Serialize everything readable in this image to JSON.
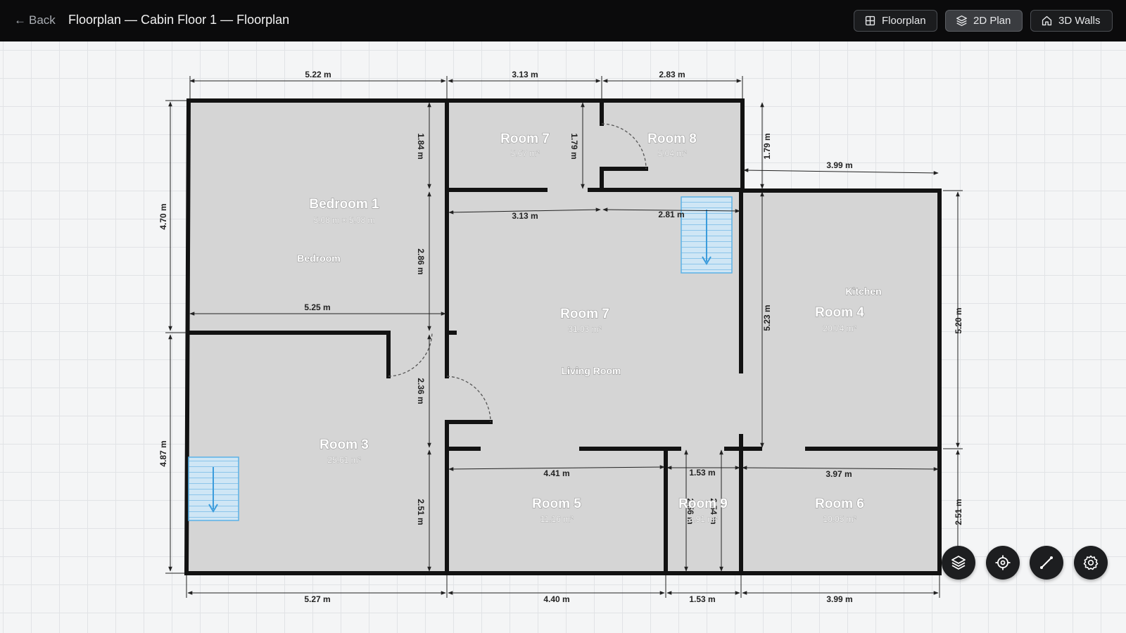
{
  "topbar": {
    "back_label": "Back",
    "title": "Floorplan — Cabin Floor 1 — Floorplan",
    "buttons": [
      {
        "label": "Floorplan",
        "icon": "grid-icon",
        "active": false
      },
      {
        "label": "2D Plan",
        "icon": "layers-icon",
        "active": true
      },
      {
        "label": "3D Walls",
        "icon": "home-icon",
        "active": false
      }
    ]
  },
  "rooms": {
    "bedroom1": {
      "name": "Bedroom 1",
      "area": "5.08 m × 5.08 m",
      "type": "Bedroom"
    },
    "room7_top": {
      "name": "Room 7",
      "area": "5.67 m²"
    },
    "room8": {
      "name": "Room 8",
      "area": "5.04 m²"
    },
    "room7_main": {
      "name": "Room 7",
      "area": "31.03 m²",
      "type": "Living Room"
    },
    "room4": {
      "name": "Room 4",
      "area": "20.74 m²",
      "type": "Kitchen"
    },
    "room3": {
      "name": "Room 3",
      "area": "25.61 m²"
    },
    "room5": {
      "name": "Room 5",
      "area": "11.16 m²"
    },
    "room9": {
      "name": "Room 9",
      "area": "3.91 m²"
    },
    "room6": {
      "name": "Room 6",
      "area": "10.05 m²"
    }
  },
  "dimensions": {
    "top_1": "5.22 m",
    "top_2": "3.13 m",
    "top_3": "2.83 m",
    "left_upper": "4.70 m",
    "left_lower": "4.87 m",
    "b1_vert": "1.84 m",
    "r7_vert": "1.79 m",
    "r8_vert": "1.79 m",
    "r4_top": "3.99 m",
    "mid_1": "3.13 m",
    "mid_2": "2.81 m",
    "b1_mid": "2.86 m",
    "b1_width": "5.25 m",
    "r7_vert_right": "5.23 m",
    "right_upper": "5.20 m",
    "door_vert": "2.36 m",
    "r5_width": "4.41 m",
    "r9_width": "1.53 m",
    "r6_width": "3.97 m",
    "r3_lower": "2.51 m",
    "r9_h1": "2.56 m",
    "r9_h2": "2.54 m",
    "right_lower": "2.51 m",
    "bot_1": "5.27 m",
    "bot_2": "4.40 m",
    "bot_3": "1.53 m",
    "bot_4": "3.99 m"
  },
  "tools": [
    {
      "name": "layers-tool",
      "icon": "layers-icon"
    },
    {
      "name": "recenter-tool",
      "icon": "target-icon"
    },
    {
      "name": "measure-tool",
      "icon": "ruler-line-icon"
    },
    {
      "name": "settings-tool",
      "icon": "gear-icon"
    }
  ],
  "colors": {
    "wall": "#121212",
    "floor": "#d5d5d5",
    "stairs": "#5bb2e6",
    "topbar": "#0b0b0c"
  }
}
